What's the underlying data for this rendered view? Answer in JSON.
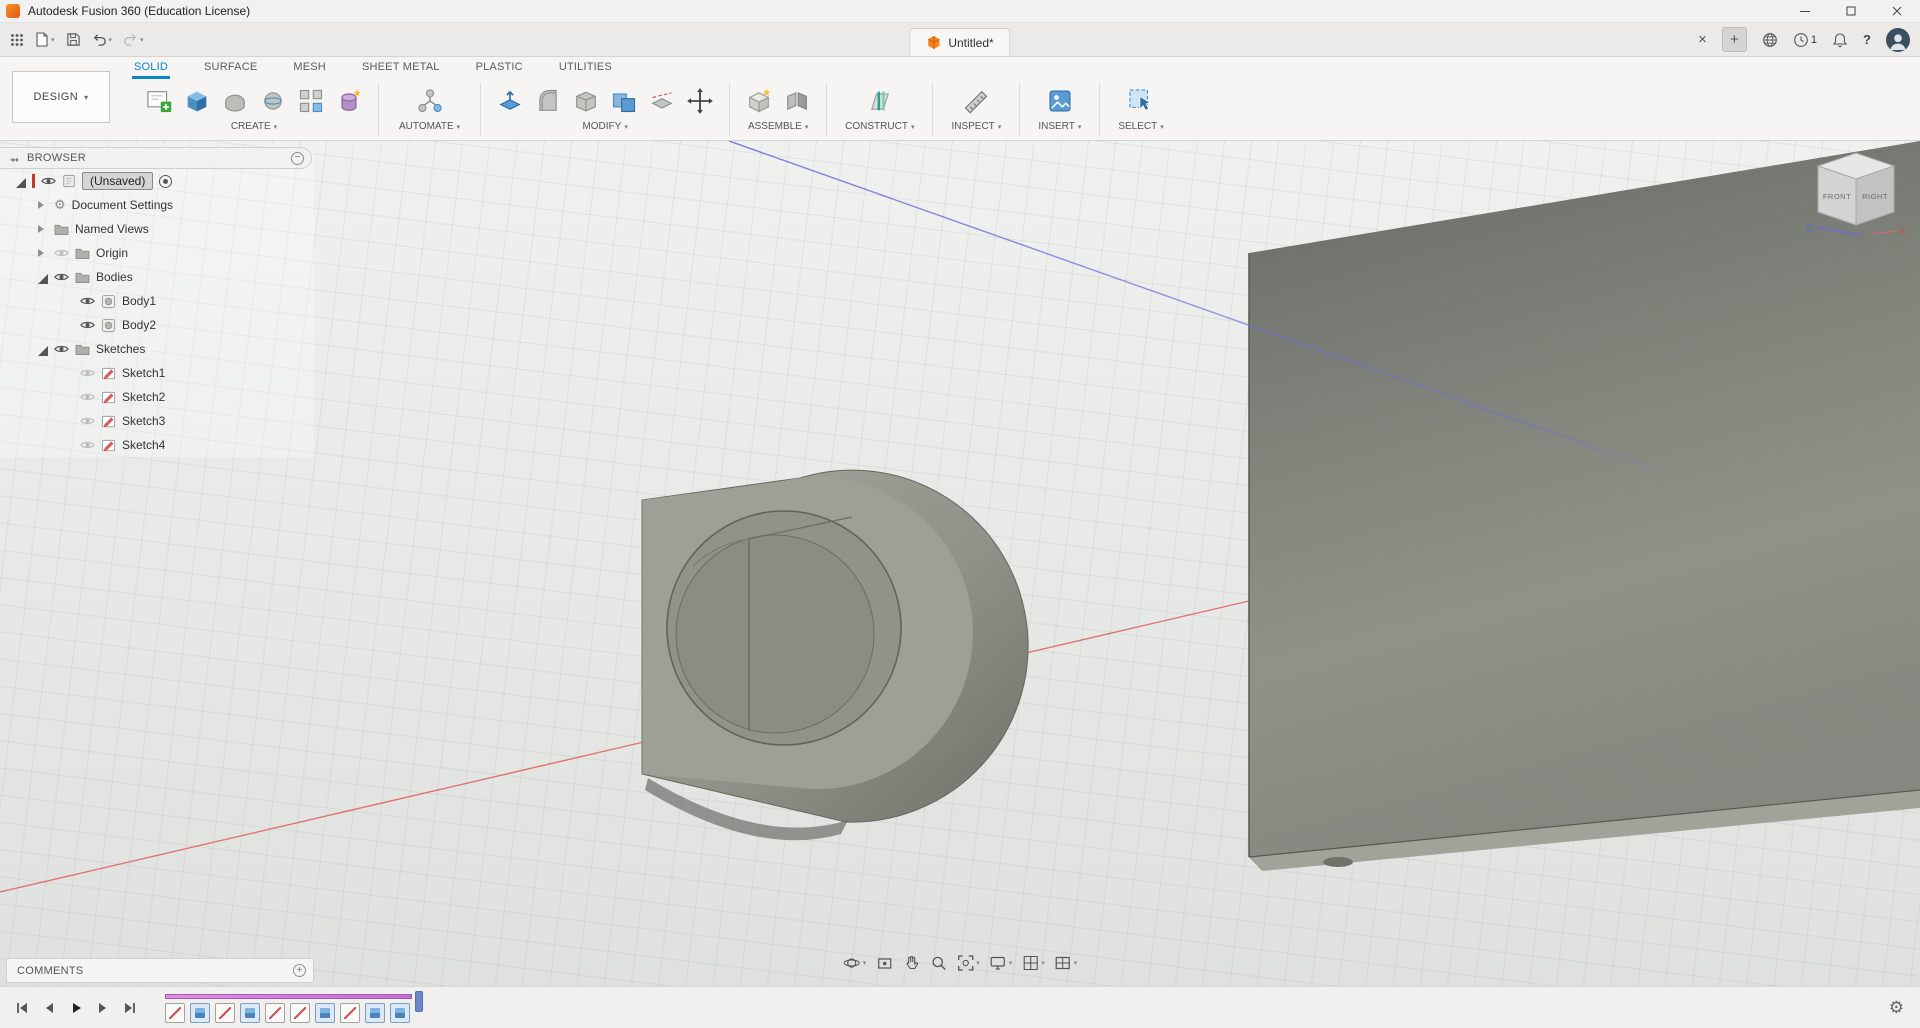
{
  "title_bar": {
    "title": "Autodesk Fusion 360 (Education License)"
  },
  "tab_bar": {
    "document_tab": "Untitled*",
    "notification_count": "1"
  },
  "toolbar": {
    "workspace": "DESIGN",
    "tabs": [
      {
        "label": "SOLID",
        "active": true
      },
      {
        "label": "SURFACE"
      },
      {
        "label": "MESH"
      },
      {
        "label": "SHEET METAL"
      },
      {
        "label": "PLASTIC"
      },
      {
        "label": "UTILITIES"
      }
    ],
    "groups": [
      {
        "label": "CREATE"
      },
      {
        "label": "AUTOMATE"
      },
      {
        "label": "MODIFY"
      },
      {
        "label": "ASSEMBLE"
      },
      {
        "label": "CONSTRUCT"
      },
      {
        "label": "INSPECT"
      },
      {
        "label": "INSERT"
      },
      {
        "label": "SELECT"
      }
    ]
  },
  "browser": {
    "header": "BROWSER",
    "items": [
      {
        "label": "(Unsaved)"
      },
      {
        "label": "Document Settings"
      },
      {
        "label": "Named Views"
      },
      {
        "label": "Origin"
      },
      {
        "label": "Bodies"
      },
      {
        "label": "Body1"
      },
      {
        "label": "Body2"
      },
      {
        "label": "Sketches"
      },
      {
        "label": "Sketch1"
      },
      {
        "label": "Sketch2"
      },
      {
        "label": "Sketch3"
      },
      {
        "label": "Sketch4"
      }
    ]
  },
  "viewport": {
    "viewcube": {
      "front_label": "FRONT",
      "right_label": "RIGHT",
      "z_axis": "Z",
      "x_axis": "X"
    }
  },
  "comments": {
    "label": "COMMENTS"
  },
  "timeline": {
    "features": [
      "sketch",
      "extrude",
      "sketch",
      "extrude",
      "sketch",
      "sketch",
      "extrude",
      "sketch",
      "extrude",
      "extrude"
    ]
  },
  "colors": {
    "accent_blue": "#0a85c7",
    "fusion_orange": "#f5841f",
    "x_axis_red": "#e25f5f",
    "z_axis_blue": "#6a6ae0",
    "timeline_range_purple": "#c36fd0"
  }
}
